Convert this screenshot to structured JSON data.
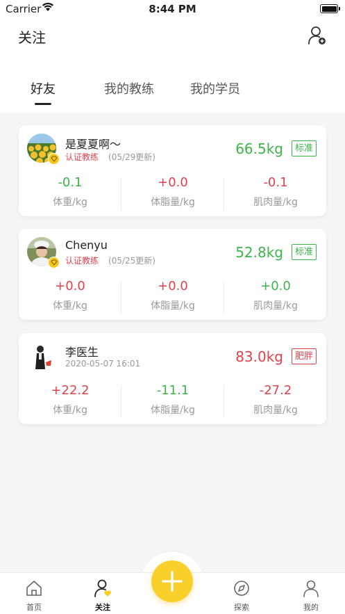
{
  "status": {
    "carrier": "Carrier",
    "time": "8:44 PM"
  },
  "header": {
    "title": "关注"
  },
  "tabs": [
    {
      "label": "好友",
      "active": true
    },
    {
      "label": "我的教练",
      "active": false
    },
    {
      "label": "我的学员",
      "active": false
    }
  ],
  "cards": [
    {
      "name": "是夏夏啊～",
      "cert": "认证教练",
      "updated": "(05/29更新)",
      "weight": "66.5kg",
      "tag": "标准",
      "tag_color": "green",
      "metrics": [
        {
          "value": "-0.1",
          "label": "体重/kg",
          "color": "green"
        },
        {
          "value": "+0.0",
          "label": "体脂量/kg",
          "color": "red"
        },
        {
          "value": "-0.1",
          "label": "肌肉量/kg",
          "color": "red"
        }
      ]
    },
    {
      "name": "Chenyu",
      "cert": "认证教练",
      "updated": "(05/25更新)",
      "weight": "52.8kg",
      "tag": "标准",
      "tag_color": "green",
      "metrics": [
        {
          "value": "+0.0",
          "label": "体重/kg",
          "color": "red"
        },
        {
          "value": "+0.0",
          "label": "体脂量/kg",
          "color": "red"
        },
        {
          "value": "+0.0",
          "label": "肌肉量/kg",
          "color": "green"
        }
      ]
    },
    {
      "name": "李医生",
      "cert": "",
      "updated": "2020-05-07 16:01",
      "weight": "83.0kg",
      "tag": "肥胖",
      "tag_color": "red",
      "metrics": [
        {
          "value": "+22.2",
          "label": "体重/kg",
          "color": "red"
        },
        {
          "value": "-11.1",
          "label": "体脂量/kg",
          "color": "green"
        },
        {
          "value": "-27.2",
          "label": "肌肉量/kg",
          "color": "red"
        }
      ]
    }
  ],
  "nav": [
    {
      "label": "首页",
      "icon": "home-icon",
      "active": false
    },
    {
      "label": "关注",
      "icon": "follow-icon",
      "active": true
    },
    {
      "label": "探索",
      "icon": "explore-icon",
      "active": false
    },
    {
      "label": "我的",
      "icon": "profile-icon",
      "active": false
    }
  ],
  "colors": {
    "green": "#3bb54a",
    "red": "#e0424d",
    "accent": "#f8d02b"
  }
}
